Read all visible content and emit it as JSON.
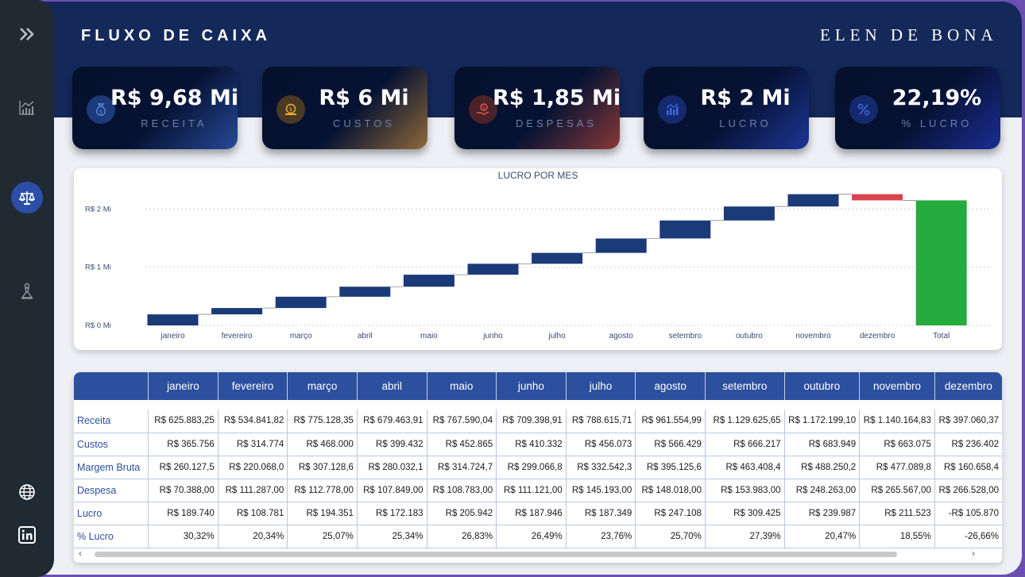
{
  "header": {
    "title": "FLUXO DE CAIXA",
    "brand": "ELEN DE BONA"
  },
  "sidebar": {
    "items": [
      {
        "icon": "chevrons-right-icon"
      },
      {
        "icon": "line-chart-icon"
      },
      {
        "icon": "balance-scale-icon",
        "active": true
      },
      {
        "icon": "chess-pawn-icon"
      },
      {
        "icon": "globe-icon"
      },
      {
        "icon": "linkedin-icon"
      }
    ]
  },
  "kpis": [
    {
      "value": "R$ 9,68 Mi",
      "label": "RECEITA",
      "icon": "money-bag-icon",
      "accent": "#3a6fd8"
    },
    {
      "value": "R$ 6 Mi",
      "label": "CUSTOS",
      "icon": "coin-icon",
      "accent": "#e8a23b"
    },
    {
      "value": "R$ 1,85 Mi",
      "label": "DESPESAS",
      "icon": "hand-coin-icon",
      "accent": "#e0523a"
    },
    {
      "value": "R$ 2 Mi",
      "label": "LUCRO",
      "icon": "bar-chart-icon",
      "accent": "#2a4fd6"
    },
    {
      "value": "22,19%",
      "label": "% LUCRO",
      "icon": "percent-icon",
      "accent": "#2a3fd6"
    }
  ],
  "chart_data": {
    "type": "waterfall",
    "title": "LUCRO POR MES",
    "categories": [
      "janeiro",
      "fevereiro",
      "março",
      "abril",
      "maio",
      "junho",
      "julho",
      "agosto",
      "setembro",
      "outubro",
      "novembro",
      "dezembro",
      "Total"
    ],
    "values": [
      189740,
      108781,
      194351,
      172183,
      205942,
      187946,
      187349,
      247108,
      309425,
      239987,
      211523,
      -105870,
      2148465
    ],
    "ylim": [
      0,
      2400000
    ],
    "yticks": [
      {
        "value": 0,
        "label": "R$ 0 Mi"
      },
      {
        "value": 1000000,
        "label": "R$ 1 Mi"
      },
      {
        "value": 2000000,
        "label": "R$ 2 Mi"
      }
    ],
    "colors": {
      "increase": "#1a3a78",
      "decrease": "#d9444e",
      "total": "#26ab3f"
    },
    "grid": true
  },
  "table": {
    "columns": [
      "",
      "janeiro",
      "fevereiro",
      "março",
      "abril",
      "maio",
      "junho",
      "julho",
      "agosto",
      "setembro",
      "outubro",
      "novembro",
      "dezembro"
    ],
    "rows": [
      {
        "label": "Receita",
        "values": [
          "R$ 625.883,25",
          "R$ 534.841,82",
          "R$ 775.128,35",
          "R$ 679.463,91",
          "R$ 767.590,04",
          "R$ 709.398,91",
          "R$ 788.615,71",
          "R$ 961.554,99",
          "R$ 1.129.625,65",
          "R$ 1.172.199,10",
          "R$ 1.140.164,83",
          "R$ 397.060,37"
        ]
      },
      {
        "label": "Custos",
        "values": [
          "R$ 365.756",
          "R$ 314.774",
          "R$ 468.000",
          "R$ 399.432",
          "R$ 452.865",
          "R$ 410.332",
          "R$ 456.073",
          "R$ 566.429",
          "R$ 666.217",
          "R$ 683.949",
          "R$ 663.075",
          "R$ 236.402"
        ]
      },
      {
        "label": "Margem Bruta",
        "values": [
          "R$ 260.127,5",
          "R$ 220.068,0",
          "R$ 307.128,6",
          "R$ 280.032,1",
          "R$ 314.724,7",
          "R$ 299.066,8",
          "R$ 332.542,3",
          "R$ 395.125,6",
          "R$ 463.408,4",
          "R$ 488.250,2",
          "R$ 477.089,8",
          "R$ 160.658,4"
        ]
      },
      {
        "label": "Despesa",
        "values": [
          "R$ 70.388,00",
          "R$ 111.287,00",
          "R$ 112.778,00",
          "R$ 107.849,00",
          "R$ 108.783,00",
          "R$ 111.121,00",
          "R$ 145.193,00",
          "R$ 148.018,00",
          "R$ 153.983,00",
          "R$ 248.263,00",
          "R$ 265.567,00",
          "R$ 266.528,00"
        ]
      },
      {
        "label": "Lucro",
        "values": [
          "R$ 189.740",
          "R$ 108.781",
          "R$ 194.351",
          "R$ 172.183",
          "R$ 205.942",
          "R$ 187.946",
          "R$ 187.349",
          "R$ 247.108",
          "R$ 309.425",
          "R$ 239.987",
          "R$ 211.523",
          "-R$ 105.870"
        ]
      },
      {
        "label": "% Lucro",
        "values": [
          "30,32%",
          "20,34%",
          "25,07%",
          "25,34%",
          "26,83%",
          "26,49%",
          "23,76%",
          "25,70%",
          "27,39%",
          "20,47%",
          "18,55%",
          "-26,66%"
        ]
      }
    ]
  }
}
